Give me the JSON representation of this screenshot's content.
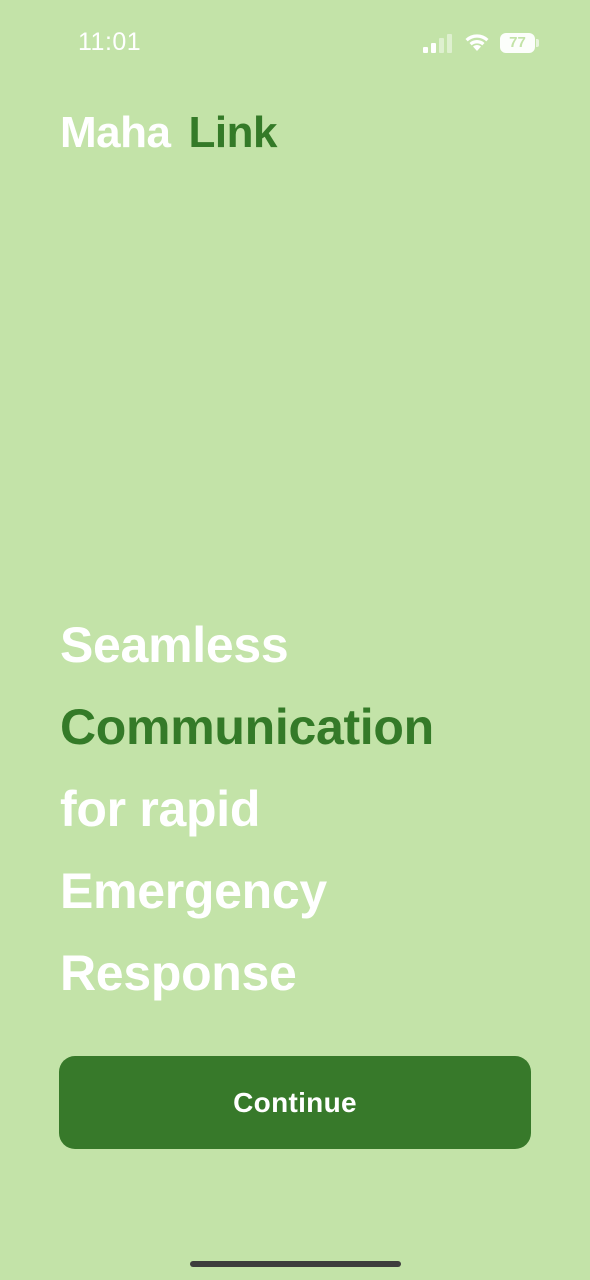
{
  "status_bar": {
    "time": "11:01",
    "battery_level": "77",
    "signal_icon": "cellular-signal-icon",
    "wifi_icon": "wifi-icon"
  },
  "brand": {
    "first": "Maha",
    "second": "Link"
  },
  "headline": {
    "line1": "Seamless",
    "line2": "Communication",
    "line3": "for rapid",
    "line4": "Emergency",
    "line5": "Response"
  },
  "actions": {
    "continue_label": "Continue"
  },
  "colors": {
    "background": "#c3e3a8",
    "accent_green": "#347a28",
    "button_green": "#37792a",
    "text_white": "#ffffff"
  }
}
